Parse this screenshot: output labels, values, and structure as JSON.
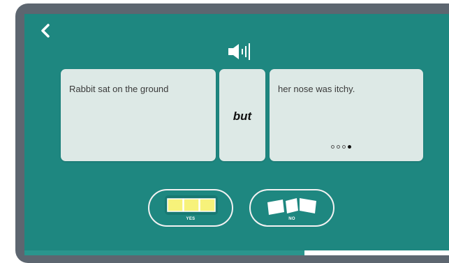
{
  "sentence": {
    "clause_left": "Rabbit sat on the ground",
    "conjunction": "but",
    "clause_right": "her nose was itchy."
  },
  "pagination": {
    "total": 4,
    "current": 4
  },
  "answers": {
    "yes_label": "YES",
    "no_label": "NO",
    "yes_icon": "connected-blocks-icon",
    "no_icon": "broken-blocks-icon"
  },
  "progress": {
    "fraction": 0.66
  },
  "colors": {
    "background": "#1e8780",
    "card": "#dde9e6",
    "frame": "#5d6670",
    "yes_blocks": "#f7f27a",
    "progress_fill": "#2a958d",
    "progress_track": "#ffffff"
  }
}
